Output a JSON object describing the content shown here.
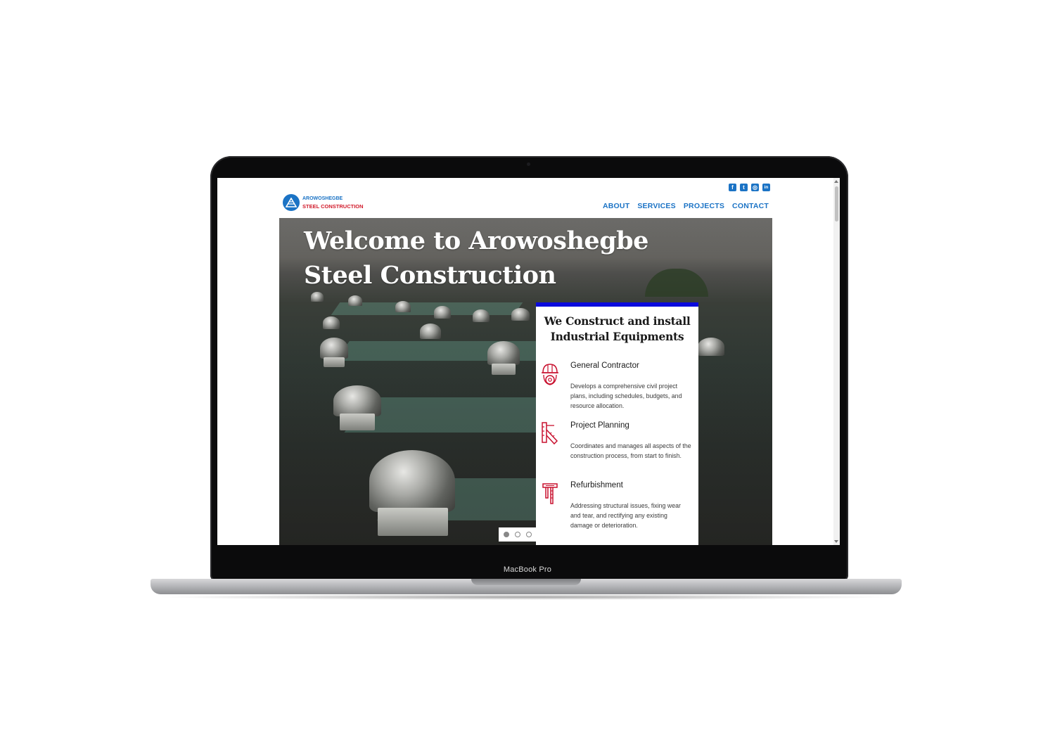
{
  "device": {
    "label": "MacBook Pro"
  },
  "site": {
    "logo": {
      "line1": "AROWOSHEGBE",
      "line2": "STEEL CONSTRUCTION"
    },
    "social": [
      {
        "icon": "facebook-icon",
        "glyph": "f"
      },
      {
        "icon": "twitter-icon",
        "glyph": "t"
      },
      {
        "icon": "instagram-icon",
        "glyph": "◎"
      },
      {
        "icon": "linkedin-icon",
        "glyph": "in"
      }
    ],
    "nav": [
      "ABOUT",
      "SERVICES",
      "PROJECTS",
      "CONTACT"
    ],
    "hero": {
      "title": "Welcome to Arowoshegbe Steel Construction"
    },
    "card": {
      "title": "We Construct and install Industrial Equipments",
      "services": [
        {
          "icon": "helmet-gear-icon",
          "name": "General Contractor",
          "desc": "Develops a comprehensive civil project plans, including schedules, budgets, and resource allocation."
        },
        {
          "icon": "ruler-square-icon",
          "name": "Project Planning",
          "desc": "Coordinates and manages all aspects of the construction process, from start to finish."
        },
        {
          "icon": "caliper-icon",
          "name": "Refurbishment",
          "desc": "Addressing structural issues, fixing wear and tear, and rectifying any existing damage or deterioration."
        }
      ]
    },
    "carousel": {
      "count": 3,
      "active": 1
    }
  },
  "colors": {
    "brand_blue": "#1b73c5",
    "brand_red": "#d11a2a",
    "card_top": "#0a0adc",
    "icon_red": "#c8102e"
  }
}
